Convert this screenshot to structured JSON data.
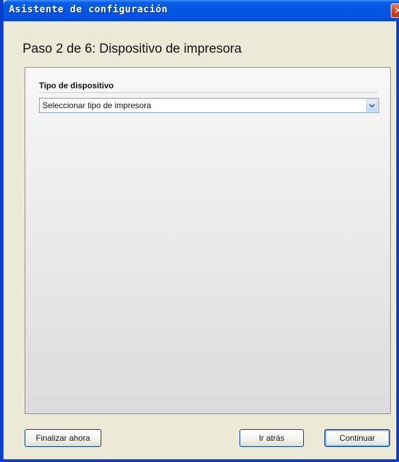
{
  "window": {
    "title": "Asistente de configuración",
    "close_icon": "close-icon"
  },
  "wizard": {
    "step_title": "Paso 2 de 6: Dispositivo de impresora"
  },
  "device_section": {
    "label": "Tipo de dispositivo",
    "dropdown": {
      "selected_value": "Seleccionar tipo de impresora",
      "icon": "chevron-down-icon"
    }
  },
  "footer": {
    "finish_label": "Finalizar ahora",
    "back_label": "Ir atrás",
    "continue_label": "Continuar"
  },
  "colors": {
    "titlebar": "#0256e0",
    "window_frame": "#0a3dcc",
    "close_button": "#d2451c",
    "dialog_background": "#ece9d8"
  }
}
